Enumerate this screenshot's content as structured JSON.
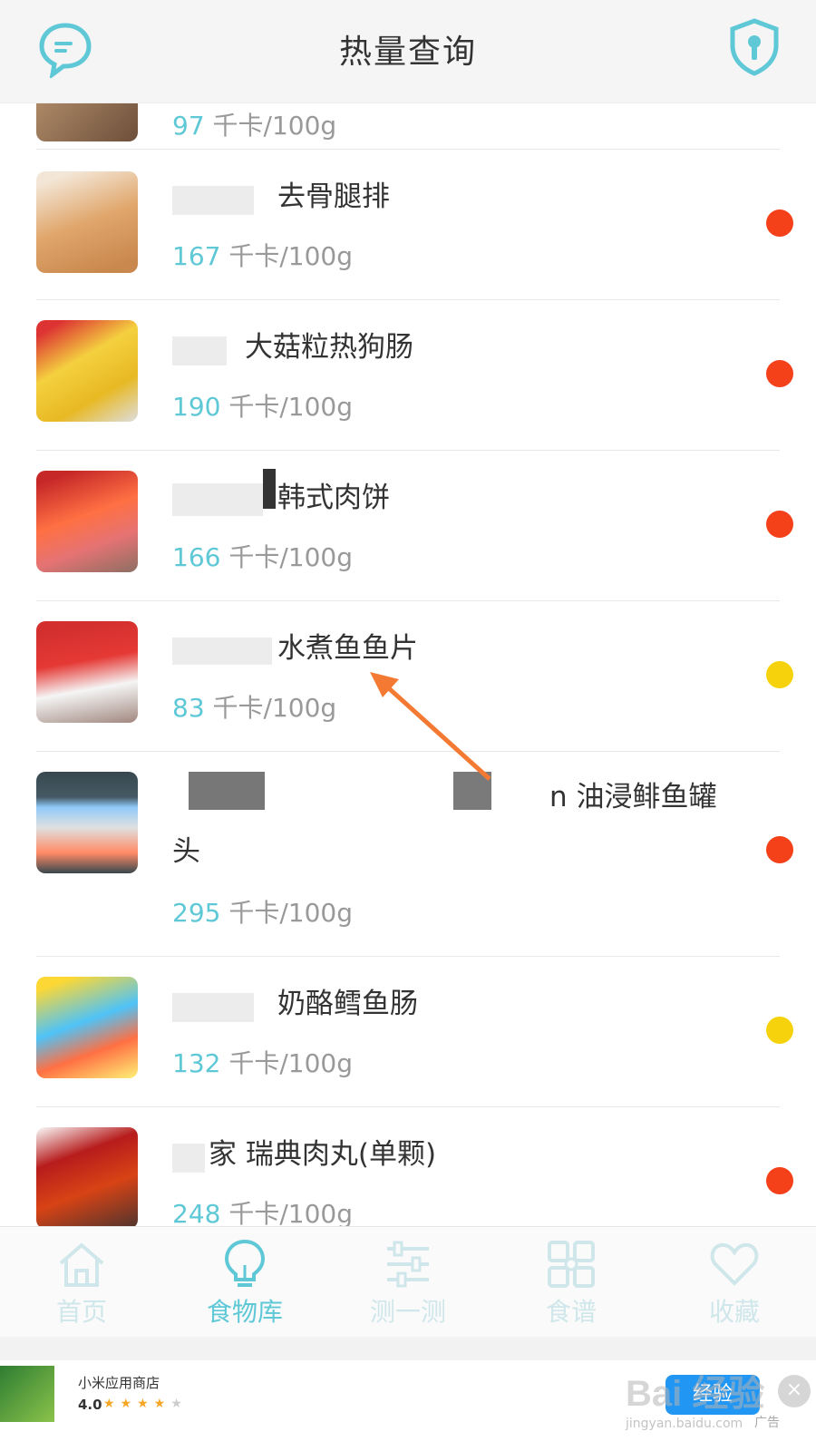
{
  "header": {
    "title": "热量查询"
  },
  "calorie_unit": "千卡/100g",
  "items": [
    {
      "name": "",
      "calories": "97",
      "level": "yellow"
    },
    {
      "name": "去骨腿排",
      "calories": "167",
      "level": "red"
    },
    {
      "name": "大菇粒热狗肠",
      "calories": "190",
      "level": "red"
    },
    {
      "name": "韩式肉饼",
      "calories": "166",
      "level": "red"
    },
    {
      "name": "水煮鱼鱼片",
      "calories": "83",
      "level": "yellow"
    },
    {
      "name": "油浸鲱鱼罐",
      "name_line2": "头",
      "name_prefix": "n",
      "calories": "295",
      "level": "red"
    },
    {
      "name": "奶酪鳕鱼肠",
      "calories": "132",
      "level": "yellow"
    },
    {
      "name": "瑞典肉丸(单颗)",
      "name_prefix": "家",
      "calories": "248",
      "level": "red"
    }
  ],
  "colors": {
    "red": "#f4411a",
    "yellow": "#f6d20c",
    "accent": "#5ec8d6"
  },
  "nav": [
    {
      "label": "首页",
      "icon": "home-icon",
      "active": false
    },
    {
      "label": "食物库",
      "icon": "bulb-icon",
      "active": true
    },
    {
      "label": "测一测",
      "icon": "sliders-icon",
      "active": false
    },
    {
      "label": "食谱",
      "icon": "grid-icon",
      "active": false
    },
    {
      "label": "收藏",
      "icon": "heart-icon",
      "active": false
    }
  ],
  "ad": {
    "store_name": "小米应用商店",
    "rating": "4.0",
    "button_label": "经验",
    "ad_tag": "广告",
    "watermark": "Bai 经验",
    "watermark_url": "jingyan.baidu.com"
  }
}
